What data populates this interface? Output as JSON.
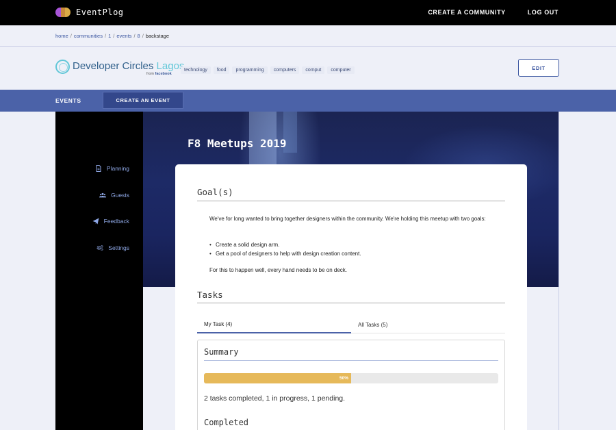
{
  "app": {
    "name": "EventPlog",
    "nav": {
      "create_community": "CREATE A COMMUNITY",
      "logout": "LOG OUT"
    }
  },
  "breadcrumb": {
    "items": [
      "home",
      "communities",
      "1",
      "events",
      "8"
    ],
    "current": "backstage",
    "separator": "/"
  },
  "community": {
    "name": "Developer Circles",
    "city": "Lagos",
    "from_prefix": "from",
    "from_brand": "facebook",
    "tags": [
      "technology",
      "food",
      "programming",
      "computers",
      "comput",
      "computer"
    ],
    "edit_label": "EDIT"
  },
  "events_bar": {
    "label": "EVENTS",
    "create_label": "CREATE AN EVENT"
  },
  "sidebar": {
    "items": [
      {
        "label": "Planning",
        "icon": "document-icon"
      },
      {
        "label": "Guests",
        "icon": "users-icon"
      },
      {
        "label": "Feedback",
        "icon": "paper-plane-icon"
      },
      {
        "label": "Settings",
        "icon": "gears-icon"
      }
    ]
  },
  "event": {
    "title": "F8 Meetups 2019",
    "goals_heading": "Goal(s)",
    "goals_intro": "We've for long wanted to bring together designers within the community. We're holding this meetup with two goals:",
    "goals": [
      "Create a solid design arm.",
      "Get a pool of designers to help with design creation content."
    ],
    "goals_outro": "For this to happen well, every hand needs to be on deck.",
    "tasks_heading": "Tasks",
    "tabs": [
      {
        "label": "My Task (4)",
        "active": true
      },
      {
        "label": "All Tasks (5)",
        "active": false
      }
    ],
    "summary": {
      "heading": "Summary",
      "progress_percent": 50,
      "progress_label": "50%",
      "status_text": "2 tasks completed, 1 in progress, 1 pending."
    },
    "completed_heading": "Completed"
  },
  "colors": {
    "accent": "#4b62a8",
    "progress": "#e6b95a",
    "sidebar_link": "#8fa8e6"
  }
}
